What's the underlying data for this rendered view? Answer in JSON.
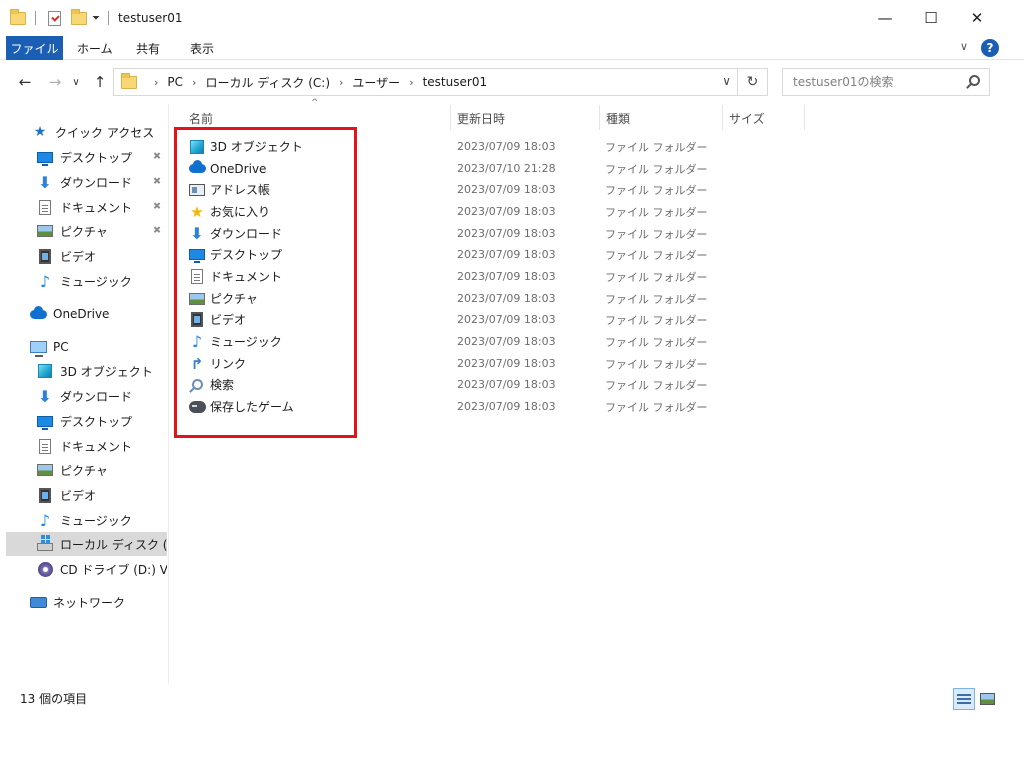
{
  "window": {
    "title": "testuser01",
    "minimize": "—",
    "maximize": "☐",
    "close": "✕"
  },
  "ribbon": {
    "tabs": [
      "ファイル",
      "ホーム",
      "共有",
      "表示"
    ],
    "collapse_chevron": "∨",
    "help": "?"
  },
  "nav": {
    "back": "←",
    "forward": "→",
    "up": "↑"
  },
  "address": {
    "crumbs": [
      "PC",
      "ローカル ディスク (C:)",
      "ユーザー",
      "testuser01"
    ],
    "dropdown": "∨",
    "refresh": "↻"
  },
  "search": {
    "placeholder": "testuser01の検索"
  },
  "sidebar": {
    "items": [
      {
        "label": "クイック アクセス",
        "icon": "star-icon"
      },
      {
        "label": "デスクトップ",
        "icon": "desktop-icon",
        "pinned": true
      },
      {
        "label": "ダウンロード",
        "icon": "download-icon",
        "pinned": true
      },
      {
        "label": "ドキュメント",
        "icon": "document-icon",
        "pinned": true
      },
      {
        "label": "ピクチャ",
        "icon": "pictures-icon",
        "pinned": true
      },
      {
        "label": "ビデオ",
        "icon": "video-icon"
      },
      {
        "label": "ミュージック",
        "icon": "music-icon"
      },
      {
        "label": "OneDrive",
        "icon": "onedrive-icon"
      },
      {
        "label": "PC",
        "icon": "pc-icon"
      },
      {
        "label": "3D オブジェクト",
        "icon": "3d-objects-icon"
      },
      {
        "label": "ダウンロード",
        "icon": "download-icon"
      },
      {
        "label": "デスクトップ",
        "icon": "desktop-icon"
      },
      {
        "label": "ドキュメント",
        "icon": "document-icon"
      },
      {
        "label": "ピクチャ",
        "icon": "pictures-icon"
      },
      {
        "label": "ビデオ",
        "icon": "video-icon"
      },
      {
        "label": "ミュージック",
        "icon": "music-icon"
      },
      {
        "label": "ローカル ディスク (C:)",
        "icon": "local-disk-icon",
        "selected": true
      },
      {
        "label": "CD ドライブ (D:) Virtu",
        "icon": "cd-drive-icon"
      },
      {
        "label": "ネットワーク",
        "icon": "network-icon"
      }
    ],
    "pin_glyph": "📌"
  },
  "columns": {
    "name": "名前",
    "date": "更新日時",
    "type": "種類",
    "size": "サイズ",
    "sort_indicator": "^"
  },
  "files": [
    {
      "name": "3D オブジェクト",
      "date": "2023/07/09 18:03",
      "type": "ファイル フォルダー",
      "icon": "3d-objects-icon"
    },
    {
      "name": "OneDrive",
      "date": "2023/07/10 21:28",
      "type": "ファイル フォルダー",
      "icon": "onedrive-icon"
    },
    {
      "name": "アドレス帳",
      "date": "2023/07/09 18:03",
      "type": "ファイル フォルダー",
      "icon": "contacts-icon"
    },
    {
      "name": "お気に入り",
      "date": "2023/07/09 18:03",
      "type": "ファイル フォルダー",
      "icon": "favorites-icon"
    },
    {
      "name": "ダウンロード",
      "date": "2023/07/09 18:03",
      "type": "ファイル フォルダー",
      "icon": "download-icon"
    },
    {
      "name": "デスクトップ",
      "date": "2023/07/09 18:03",
      "type": "ファイル フォルダー",
      "icon": "desktop-icon"
    },
    {
      "name": "ドキュメント",
      "date": "2023/07/09 18:03",
      "type": "ファイル フォルダー",
      "icon": "document-icon"
    },
    {
      "name": "ピクチャ",
      "date": "2023/07/09 18:03",
      "type": "ファイル フォルダー",
      "icon": "pictures-icon"
    },
    {
      "name": "ビデオ",
      "date": "2023/07/09 18:03",
      "type": "ファイル フォルダー",
      "icon": "video-icon"
    },
    {
      "name": "ミュージック",
      "date": "2023/07/09 18:03",
      "type": "ファイル フォルダー",
      "icon": "music-icon"
    },
    {
      "name": "リンク",
      "date": "2023/07/09 18:03",
      "type": "ファイル フォルダー",
      "icon": "links-icon"
    },
    {
      "name": "検索",
      "date": "2023/07/09 18:03",
      "type": "ファイル フォルダー",
      "icon": "searches-icon"
    },
    {
      "name": "保存したゲーム",
      "date": "2023/07/09 18:03",
      "type": "ファイル フォルダー",
      "icon": "saved-games-icon"
    }
  ],
  "status": {
    "item_count": "13 個の項目"
  },
  "colors": {
    "accent": "#1a5fb4",
    "highlight_frame": "#e5121b",
    "selected_bg": "#d9d9d9"
  }
}
